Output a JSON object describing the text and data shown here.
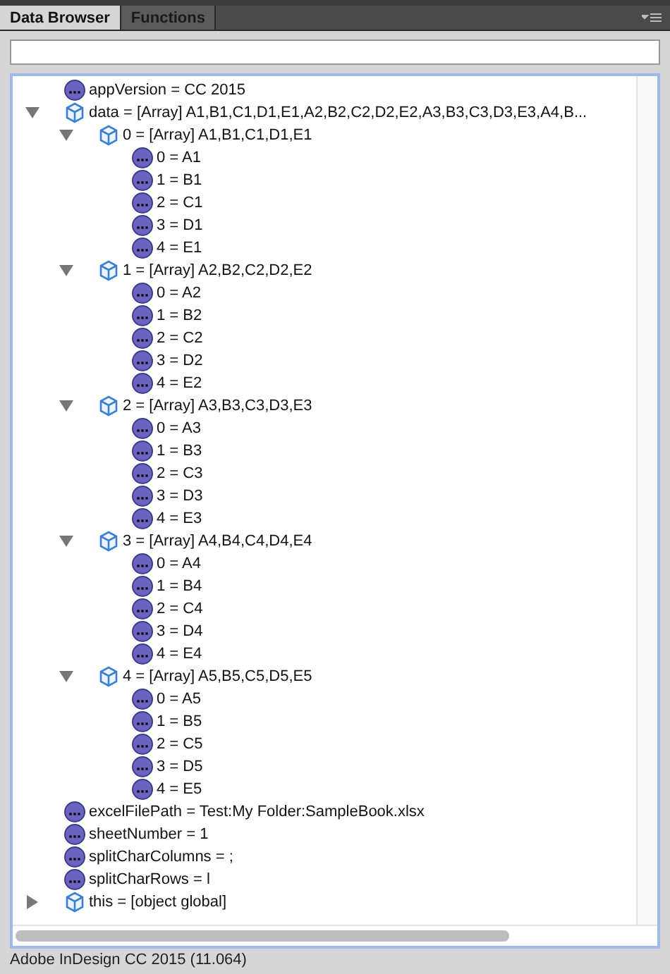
{
  "tabs": [
    {
      "label": "Data Browser",
      "selected": true
    },
    {
      "label": "Functions",
      "selected": false
    }
  ],
  "tree": [
    {
      "kind": "value",
      "text": "appVersion = CC 2015"
    },
    {
      "kind": "object",
      "expanded": true,
      "text": "data = [Array] A1,B1,C1,D1,E1,A2,B2,C2,D2,E2,A3,B3,C3,D3,E3,A4,B...",
      "children": [
        {
          "kind": "object",
          "expanded": true,
          "text": "0 = [Array] A1,B1,C1,D1,E1",
          "children": [
            {
              "kind": "value",
              "text": "0 = A1"
            },
            {
              "kind": "value",
              "text": "1 = B1"
            },
            {
              "kind": "value",
              "text": "2 = C1"
            },
            {
              "kind": "value",
              "text": "3 = D1"
            },
            {
              "kind": "value",
              "text": "4 = E1"
            }
          ]
        },
        {
          "kind": "object",
          "expanded": true,
          "text": "1 = [Array] A2,B2,C2,D2,E2",
          "children": [
            {
              "kind": "value",
              "text": "0 = A2"
            },
            {
              "kind": "value",
              "text": "1 = B2"
            },
            {
              "kind": "value",
              "text": "2 = C2"
            },
            {
              "kind": "value",
              "text": "3 = D2"
            },
            {
              "kind": "value",
              "text": "4 = E2"
            }
          ]
        },
        {
          "kind": "object",
          "expanded": true,
          "text": "2 = [Array] A3,B3,C3,D3,E3",
          "children": [
            {
              "kind": "value",
              "text": "0 = A3"
            },
            {
              "kind": "value",
              "text": "1 = B3"
            },
            {
              "kind": "value",
              "text": "2 = C3"
            },
            {
              "kind": "value",
              "text": "3 = D3"
            },
            {
              "kind": "value",
              "text": "4 = E3"
            }
          ]
        },
        {
          "kind": "object",
          "expanded": true,
          "text": "3 = [Array] A4,B4,C4,D4,E4",
          "children": [
            {
              "kind": "value",
              "text": "0 = A4"
            },
            {
              "kind": "value",
              "text": "1 = B4"
            },
            {
              "kind": "value",
              "text": "2 = C4"
            },
            {
              "kind": "value",
              "text": "3 = D4"
            },
            {
              "kind": "value",
              "text": "4 = E4"
            }
          ]
        },
        {
          "kind": "object",
          "expanded": true,
          "text": "4 = [Array] A5,B5,C5,D5,E5",
          "children": [
            {
              "kind": "value",
              "text": "0 = A5"
            },
            {
              "kind": "value",
              "text": "1 = B5"
            },
            {
              "kind": "value",
              "text": "2 = C5"
            },
            {
              "kind": "value",
              "text": "3 = D5"
            },
            {
              "kind": "value",
              "text": "4 = E5"
            }
          ]
        }
      ]
    },
    {
      "kind": "value",
      "text": "excelFilePath = Test:My Folder:SampleBook.xlsx"
    },
    {
      "kind": "value",
      "text": "sheetNumber = 1"
    },
    {
      "kind": "value",
      "text": "splitCharColumns = ;"
    },
    {
      "kind": "value",
      "text": "splitCharRows = l"
    },
    {
      "kind": "object",
      "expanded": false,
      "text": "this = [object global]"
    }
  ],
  "status_bar": "Adobe InDesign CC 2015 (11.064)"
}
